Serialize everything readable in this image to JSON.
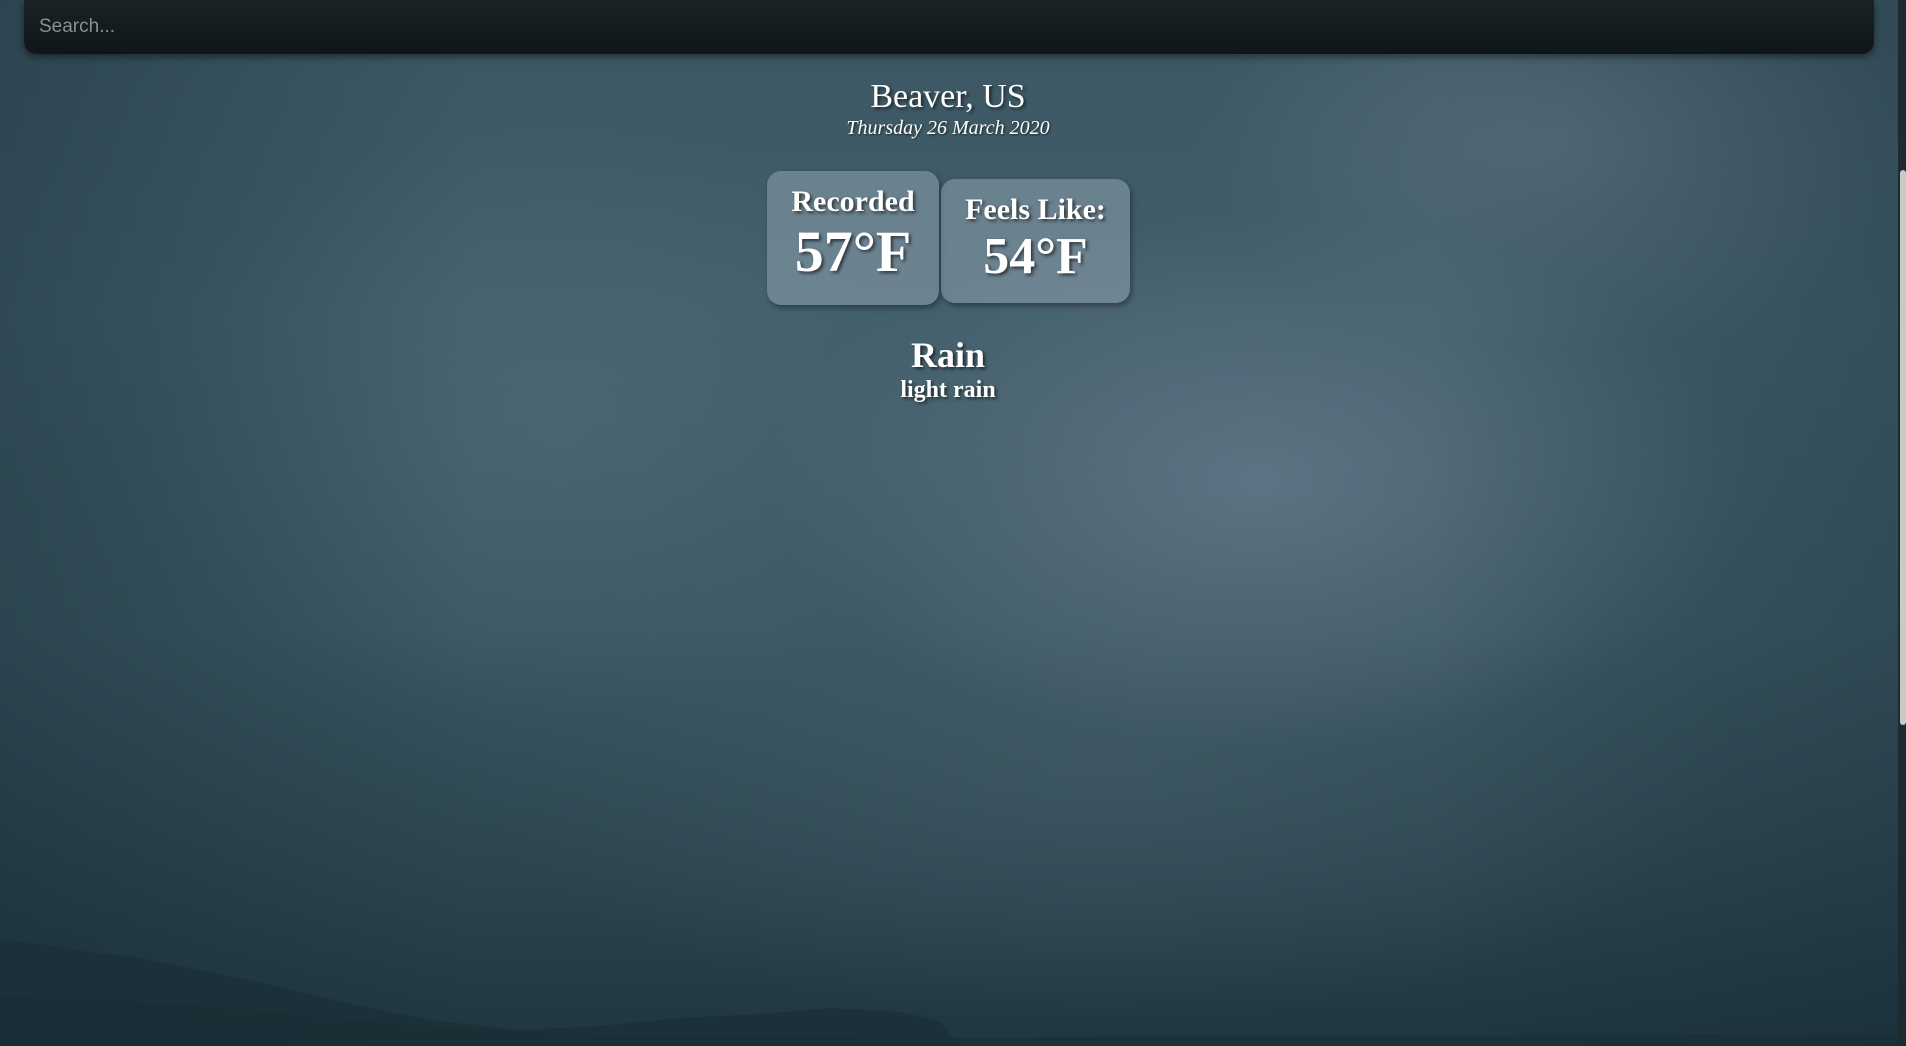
{
  "search": {
    "placeholder": "Search...",
    "value": ""
  },
  "location": {
    "name": "Beaver, US",
    "date": "Thursday 26 March 2020"
  },
  "temperature": {
    "recorded_label": "Recorded",
    "recorded_value": "57°F",
    "feels_like_label": "Feels Like:",
    "feels_like_value": "54°F"
  },
  "weather": {
    "main": "Rain",
    "description": "light rain"
  },
  "colors": {
    "text": "#ffffff",
    "search_bar": "#12191c",
    "card": "#8898a6"
  }
}
